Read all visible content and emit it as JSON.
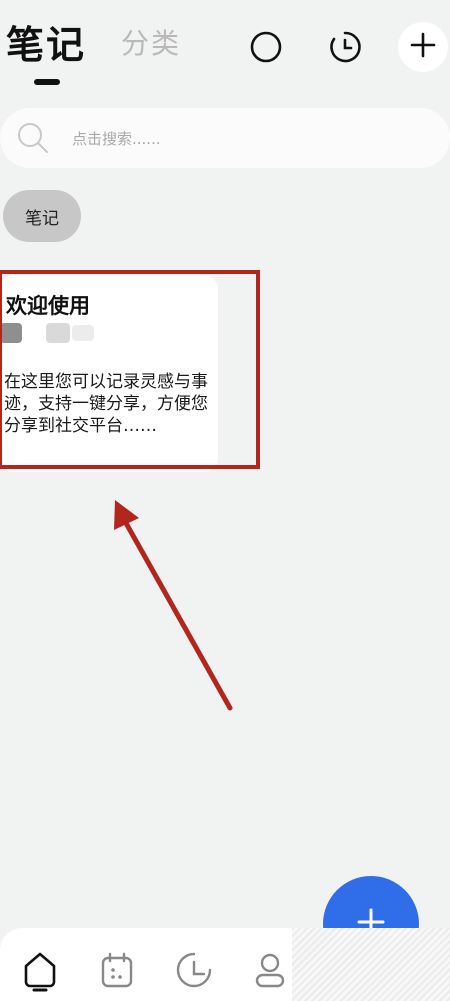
{
  "header": {
    "active_tab": "笔记",
    "inactive_tab": "分类"
  },
  "search": {
    "placeholder": "点击搜索......"
  },
  "categories": [
    {
      "label": "笔记"
    }
  ],
  "notes": [
    {
      "title": "欢迎使用",
      "body": "在这里您可以记录灵感与事迹，支持一键分享，方便您分享到社交平台……"
    }
  ],
  "colors": {
    "accent": "#2f6ee8",
    "highlight": "#b2261e",
    "background": "#f1f2f2"
  },
  "icons": {
    "header": [
      "circle-icon",
      "clock-icon",
      "plus-icon"
    ],
    "nav": [
      "home-icon",
      "calendar-icon",
      "stats-icon",
      "profile-icon"
    ]
  }
}
